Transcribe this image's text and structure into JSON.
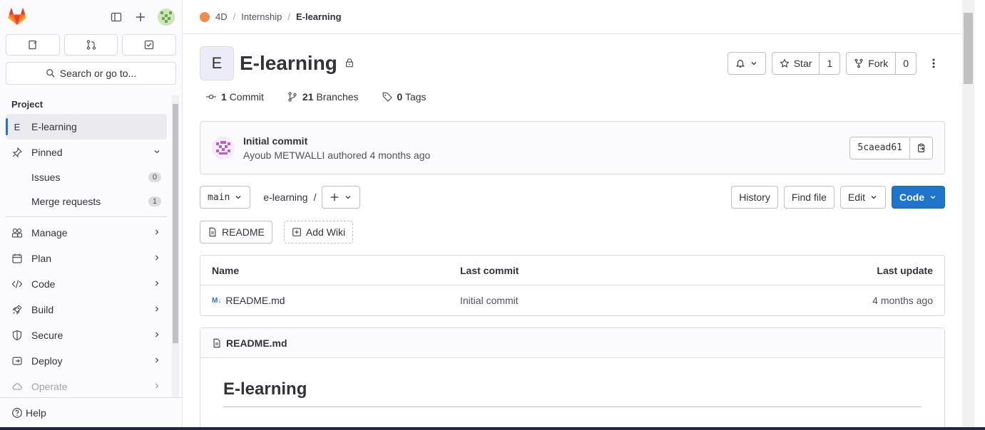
{
  "sidebar": {
    "search_placeholder": "Search or go to...",
    "section_title": "Project",
    "project_item": {
      "badge": "E",
      "label": "E-learning"
    },
    "pinned_label": "Pinned",
    "pinned_items": [
      {
        "label": "Issues",
        "count": "0"
      },
      {
        "label": "Merge requests",
        "count": "1"
      }
    ],
    "nav_items": [
      {
        "label": "Manage",
        "icon": "users-icon"
      },
      {
        "label": "Plan",
        "icon": "calendar-icon"
      },
      {
        "label": "Code",
        "icon": "code-icon"
      },
      {
        "label": "Build",
        "icon": "rocket-icon"
      },
      {
        "label": "Secure",
        "icon": "shield-icon"
      },
      {
        "label": "Deploy",
        "icon": "deploy-icon"
      },
      {
        "label": "Operate",
        "icon": "cloud-icon"
      }
    ],
    "help_label": "Help"
  },
  "breadcrumbs": [
    "4D",
    "Internship",
    "E-learning"
  ],
  "project": {
    "avatar_letter": "E",
    "title": "E-learning",
    "star_label": "Star",
    "star_count": "1",
    "fork_label": "Fork",
    "fork_count": "0"
  },
  "stats": {
    "commits_count": "1",
    "commits_label": "Commit",
    "branches_count": "21",
    "branches_label": "Branches",
    "tags_count": "0",
    "tags_label": "Tags"
  },
  "commit": {
    "title": "Initial commit",
    "author": "Ayoub METWALLI",
    "meta": "authored 4 months ago",
    "sha": "5caead61"
  },
  "toolbar": {
    "branch": "main",
    "path": "e-learning",
    "path_sep": "/",
    "history": "History",
    "find_file": "Find file",
    "edit": "Edit",
    "code": "Code"
  },
  "wiki": {
    "readme": "README",
    "add_wiki": "Add Wiki"
  },
  "files": {
    "headers": {
      "name": "Name",
      "last_commit": "Last commit",
      "last_update": "Last update"
    },
    "rows": [
      {
        "name": "README.md",
        "last_commit": "Initial commit",
        "last_update": "4 months ago"
      }
    ]
  },
  "readme": {
    "filename": "README.md",
    "heading": "E-learning"
  },
  "colors": {
    "accent": "#1f75cb",
    "logo": "#e24329"
  }
}
